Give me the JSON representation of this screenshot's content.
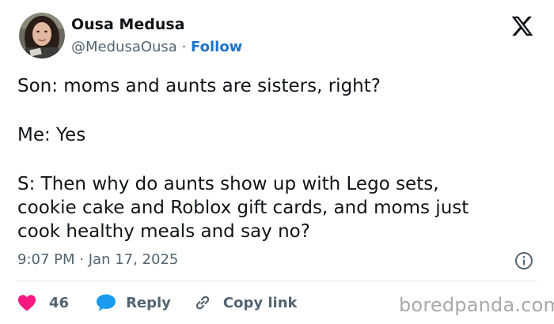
{
  "author": {
    "name": "Ousa Medusa",
    "handle": "@MedusaOusa",
    "separator": "·",
    "follow_label": "Follow"
  },
  "tweet": {
    "lines": [
      "Son: moms and aunts are sisters, right?",
      "Me: Yes",
      "S: Then why do aunts show up with Lego sets,",
      "cookie cake and Roblox gift cards, and moms just",
      "cook healthy meals and say no?"
    ],
    "time": "9:07 PM",
    "separator": "·",
    "date": "Jan 17, 2025"
  },
  "actions": {
    "like_count": "46",
    "reply_label": "Reply",
    "copy_link_label": "Copy link"
  },
  "watermark": "boredpanda.com",
  "icons": [
    "avatar-photo",
    "x-logo-icon",
    "info-icon",
    "heart-icon",
    "reply-bubble-icon",
    "link-icon"
  ],
  "colors": {
    "text": "#0f1419",
    "muted": "#536471",
    "follow": "#1d74c9",
    "heart": "#f91880",
    "reply": "#1d9bf0",
    "watermark": "#a7a9ac"
  }
}
